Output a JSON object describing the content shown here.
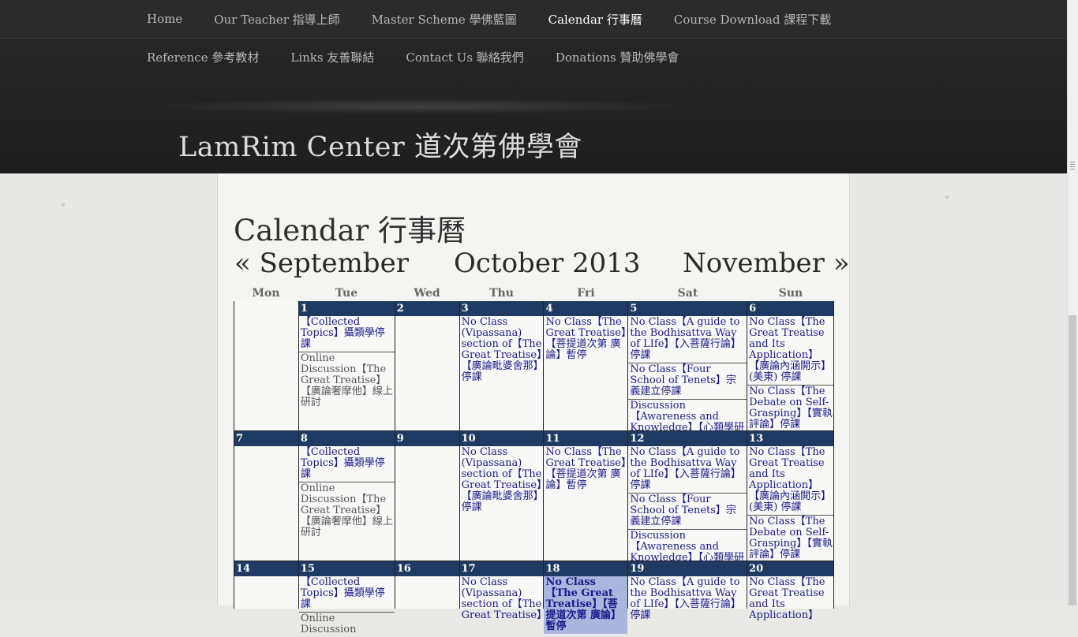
{
  "nav": {
    "row1": [
      "Home",
      "Our Teacher 指導上師",
      "Master Scheme 學佛藍圖",
      "Calendar 行事曆",
      "Course Download 課程下載"
    ],
    "row2": [
      "Reference 參考教材",
      "Links 友善聯結",
      "Contact Us 聯絡我們",
      "Donations 贊助佛學會"
    ],
    "active": "Calendar 行事曆"
  },
  "site_title": "LamRim Center 道次第佛學會",
  "page_title": "Calendar 行事曆",
  "calendar": {
    "prev_label": "« September",
    "current_label": "October 2013",
    "next_label": "November »",
    "weekdays": [
      "Mon",
      "Tue",
      "Wed",
      "Thu",
      "Fri",
      "Sat",
      "Sun"
    ],
    "weeks": [
      {
        "days": [
          {
            "num": "",
            "events": []
          },
          {
            "num": "1",
            "events": [
              "【Collected Topics】攝類學停課",
              "Online Discussion【The Great Treatise】【廣論奢摩他】線上研討"
            ]
          },
          {
            "num": "2",
            "events": []
          },
          {
            "num": "3",
            "events": [
              "No Class (Vipassana) section of【The Great Treatise】【廣論毗婆舍那】停課"
            ]
          },
          {
            "num": "4",
            "events": [
              "No Class【The Great Treatise】【菩提道次第 廣論】暫停"
            ]
          },
          {
            "num": "5",
            "events": [
              "No Class【A guide to the Bodhisattva Way of LIfe】【入菩薩行論】停課",
              "No Class【Four School of Tenets】宗義建立停課",
              "Discussion【Awareness and Knowledge】【心類學研討】"
            ]
          },
          {
            "num": "6",
            "events": [
              "No Class【The Great Treatise and Its Application】【廣論內涵開示】(美東) 停課",
              "No Class【The Debate on Self-Grasping】【實執評論】停課"
            ]
          }
        ]
      },
      {
        "days": [
          {
            "num": "7",
            "events": []
          },
          {
            "num": "8",
            "events": [
              "【Collected Topics】攝類學停課",
              "Online Discussion【The Great Treatise】【廣論奢摩他】線上研討"
            ]
          },
          {
            "num": "9",
            "events": []
          },
          {
            "num": "10",
            "events": [
              "No Class (Vipassana) section of【The Great Treatise】【廣論毗婆舍那】停課"
            ]
          },
          {
            "num": "11",
            "events": [
              "No Class【The Great Treatise】【菩提道次第 廣論】暫停"
            ]
          },
          {
            "num": "12",
            "events": [
              "No Class【A guide to the Bodhisattva Way of LIfe】【入菩薩行論】停課",
              "No Class【Four School of Tenets】宗義建立停課",
              "Discussion【Awareness and Knowledge】【心類學研討】"
            ]
          },
          {
            "num": "13",
            "events": [
              "No Class【The Great Treatise and Its Application】【廣論內涵開示】(美東) 停課",
              "No Class【The Debate on Self-Grasping】【實執評論】停課"
            ]
          }
        ]
      },
      {
        "days": [
          {
            "num": "14",
            "events": []
          },
          {
            "num": "15",
            "events": [
              "【Collected Topics】攝類學停課",
              "Online Discussion"
            ]
          },
          {
            "num": "16",
            "events": []
          },
          {
            "num": "17",
            "events": [
              "No Class (Vipassana) section of【The Great Treatise】"
            ]
          },
          {
            "num": "18",
            "events": [
              "No Class【The Great Treatise】【菩提道次第 廣論】暫停"
            ],
            "highlight": true
          },
          {
            "num": "19",
            "events": [
              "No Class【A guide to the Bodhisattva Way of LIfe】【入菩薩行論】停課"
            ]
          },
          {
            "num": "20",
            "events": [
              "No Class【The Great Treatise and Its Application】"
            ]
          }
        ]
      }
    ]
  }
}
